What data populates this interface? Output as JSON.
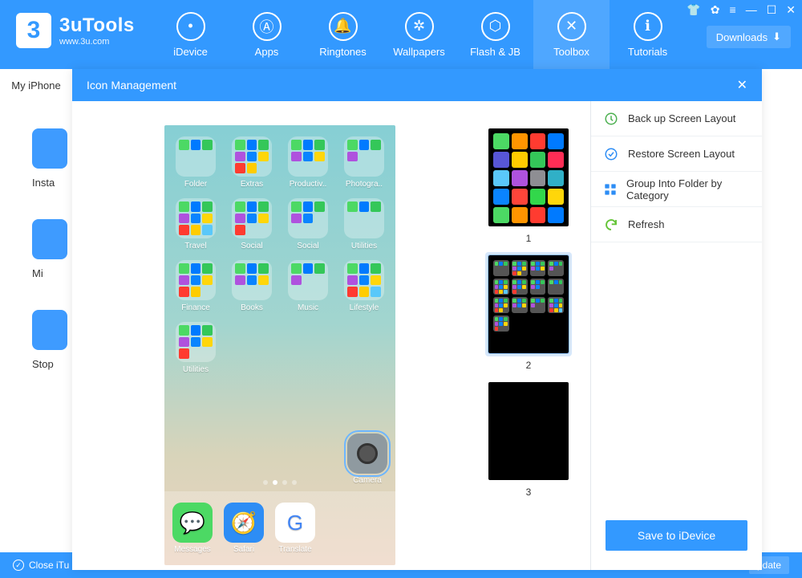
{
  "brand": {
    "title": "3uTools",
    "subtitle": "www.3u.com",
    "badge": "3"
  },
  "nav": [
    {
      "label": "iDevice",
      "icon": "apple-icon"
    },
    {
      "label": "Apps",
      "icon": "apps-icon"
    },
    {
      "label": "Ringtones",
      "icon": "bell-icon"
    },
    {
      "label": "Wallpapers",
      "icon": "flower-icon"
    },
    {
      "label": "Flash & JB",
      "icon": "box-icon"
    },
    {
      "label": "Toolbox",
      "icon": "tools-icon",
      "active": true
    },
    {
      "label": "Tutorials",
      "icon": "info-icon"
    }
  ],
  "downloads_label": "Downloads",
  "left_tab": "My iPhone",
  "side_items": [
    "Insta",
    "Mi",
    "Stop"
  ],
  "bottom": {
    "close": "Close iTu",
    "update": "pdate"
  },
  "panel": {
    "title": "Icon Management",
    "actions": [
      {
        "label": "Back up Screen Layout",
        "icon": "backup-icon",
        "color": "#4cb050"
      },
      {
        "label": "Restore Screen Layout",
        "icon": "restore-icon",
        "color": "#2d8df5"
      },
      {
        "label": "Group Into Folder by Category",
        "icon": "grid-icon",
        "color": "#2d8df5"
      },
      {
        "label": "Refresh",
        "icon": "refresh-icon",
        "color": "#64c437"
      }
    ],
    "save_label": "Save to iDevice",
    "pages": [
      {
        "num": "1"
      },
      {
        "num": "2",
        "selected": true
      },
      {
        "num": "3"
      }
    ],
    "folders": [
      "Folder",
      "Extras",
      "Productiv..",
      "Photogra..",
      "Travel",
      "Social",
      "Social",
      "Utilities",
      "Finance",
      "Books",
      "Music",
      "Lifestyle",
      "Utilities"
    ],
    "dock": [
      {
        "label": "Messages",
        "bg": "#4cd964"
      },
      {
        "label": "Safari",
        "bg": "#2d8df5"
      },
      {
        "label": "Translate",
        "bg": "#ffffff"
      }
    ],
    "camera_label": "Camera"
  },
  "palette": [
    "#4cd964",
    "#ff9500",
    "#ff3b30",
    "#007aff",
    "#5856d6",
    "#ffcc00",
    "#34c759",
    "#ff2d55",
    "#5ac8fa",
    "#af52de",
    "#8e8e93",
    "#30b0c7",
    "#0a84ff",
    "#ff453a",
    "#32d74b",
    "#ffd60a"
  ]
}
